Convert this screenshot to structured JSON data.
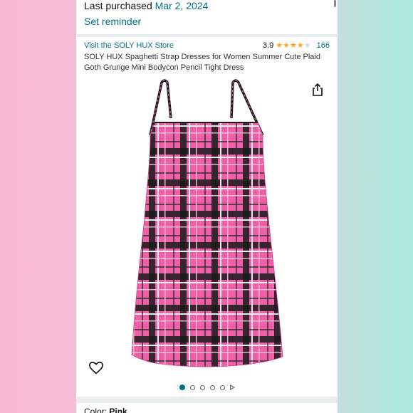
{
  "purchase": {
    "label": "Last purchased",
    "date": "Mar 2, 2024",
    "reminder": "Set reminder"
  },
  "product": {
    "store_link": "Visit the SOLY HUX Store",
    "rating_value": "3.9",
    "rating_stars": 3.9,
    "rating_count": "166",
    "title": "SOLY HUX Spaghetti Strap Dresses for Women Summer Cute Plaid Goth Grunge Mini Bodycon Pencil Tight Dress"
  },
  "carousel": {
    "dot_count": 5,
    "active_index": 0
  },
  "variant": {
    "color_label": "Color:",
    "color_value": "Pink"
  },
  "colors": {
    "link": "#007185",
    "star": "#ffa41c",
    "dress_pink": "#ee5fa5",
    "plaid_dark": "#1a1a1a"
  },
  "icons": {
    "share": "share-icon",
    "favorite": "heart-icon",
    "video": "play-icon"
  }
}
